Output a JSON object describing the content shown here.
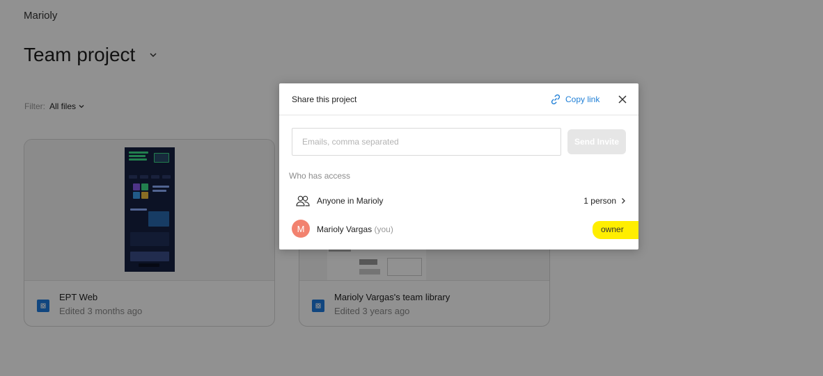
{
  "page": {
    "team_name": "Marioly",
    "project_title": "Team project",
    "filter_label": "Filter:",
    "filter_value": "All files"
  },
  "files": [
    {
      "name": "EPT Web",
      "meta": "Edited 3 months ago",
      "icon": "figma-file-icon"
    },
    {
      "name": "Marioly Vargas's team library",
      "meta": "Edited 3 years ago",
      "icon": "figma-file-icon"
    }
  ],
  "share_modal": {
    "title": "Share this project",
    "copy_link_label": "Copy link",
    "email_placeholder": "Emails, comma separated",
    "email_value": "",
    "send_label": "Send Invite",
    "access_heading": "Who has access",
    "anyone_label": "Anyone in Marioly",
    "anyone_count": "1 person",
    "user_initial": "M",
    "user_name": "Marioly Vargas",
    "user_tag": "(you)",
    "user_role": "owner"
  },
  "colors": {
    "accent_link": "#1f7fd6",
    "avatar": "#f2826f",
    "highlight": "#ffee00",
    "file_icon": "#1e7be0"
  }
}
